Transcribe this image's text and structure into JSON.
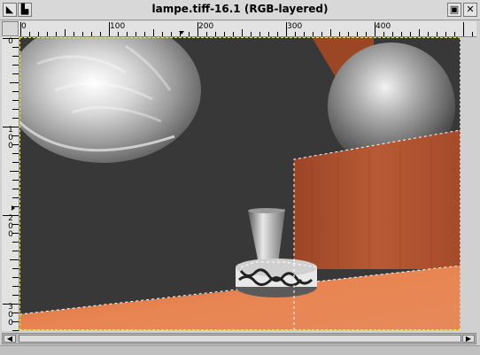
{
  "window": {
    "title": "lampe.tiff-16.1 (RGB-layered)",
    "menu_button_icon": "window-menu-icon",
    "maximize_icon": "maximize-icon",
    "close_icon": "close-icon"
  },
  "rulers": {
    "horizontal_labels": [
      "0",
      "100",
      "200",
      "300",
      "400"
    ],
    "vertical_labels": [
      "0",
      "100",
      "200",
      "300"
    ]
  },
  "canvas": {
    "background_color": "#383838",
    "wood_color": "#b0502c",
    "floor_color": "#e07a4c",
    "selection_color": "#e7e36a"
  },
  "scrollbar": {
    "left_arrow": "◀",
    "right_arrow": "▶"
  }
}
